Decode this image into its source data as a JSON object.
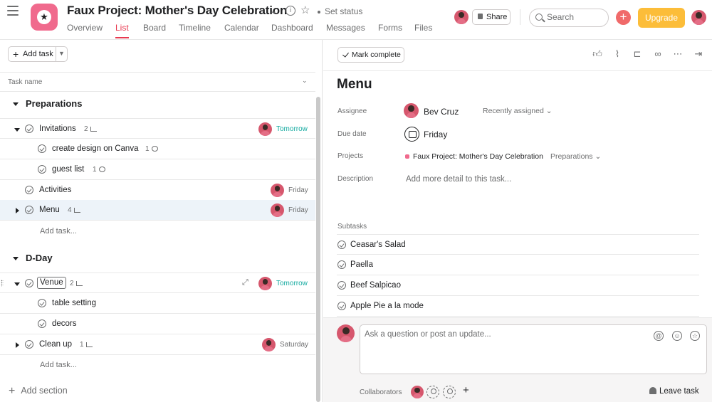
{
  "header": {
    "project_title": "Faux Project: Mother's Day Celebration",
    "set_status": "Set status",
    "share_label": "Share",
    "search_placeholder": "Search",
    "upgrade_label": "Upgrade",
    "project_icon_color": "#f06a8d",
    "accent_color": "#e8384f",
    "tabs": [
      "Overview",
      "List",
      "Board",
      "Timeline",
      "Calendar",
      "Dashboard",
      "Messages",
      "Forms",
      "Files"
    ],
    "active_tab": "List"
  },
  "list": {
    "add_task_label": "Add task",
    "column_header": "Task name",
    "add_task_link": "Add task...",
    "add_section_label": "Add section",
    "sections": [
      {
        "title": "Preparations",
        "tasks": [
          {
            "name": "Invitations",
            "count": "2",
            "count_icon": "subtask-icon",
            "due": "Tomorrow",
            "expanded": true,
            "subtasks": [
              {
                "name": "create design on Canva",
                "count": "1",
                "count_icon": "comment-icon"
              },
              {
                "name": "guest list",
                "count": "1",
                "count_icon": "comment-icon"
              }
            ]
          },
          {
            "name": "Activities",
            "due": "Friday"
          },
          {
            "name": "Menu",
            "count": "4",
            "count_icon": "subtask-icon",
            "due": "Friday",
            "selected": true
          }
        ]
      },
      {
        "title": "D-Day",
        "tasks": [
          {
            "name": "Venue",
            "count": "2",
            "count_icon": "subtask-icon",
            "due": "Tomorrow",
            "expanded": true,
            "subtasks": [
              {
                "name": "table setting"
              },
              {
                "name": "decors"
              }
            ]
          },
          {
            "name": "Clean up",
            "count": "1",
            "count_icon": "subtask-icon",
            "due": "Saturday"
          }
        ]
      }
    ]
  },
  "detail": {
    "mark_complete_label": "Mark complete",
    "title": "Menu",
    "assignee_label": "Assignee",
    "assignee_name": "Bev Cruz",
    "recently_assigned": "Recently assigned",
    "due_label": "Due date",
    "due_value": "Friday",
    "projects_label": "Projects",
    "project_name": "Faux Project: Mother's Day Celebration",
    "project_section": "Preparations",
    "description_label": "Description",
    "description_placeholder": "Add more detail to this task...",
    "subtasks_label": "Subtasks",
    "subtasks": [
      "Ceasar's Salad",
      "Paella",
      "Beef Salpicao",
      "Apple Pie a la mode"
    ],
    "comment_placeholder": "Ask a question or post an update...",
    "collaborators_label": "Collaborators",
    "leave_task_label": "Leave task"
  }
}
